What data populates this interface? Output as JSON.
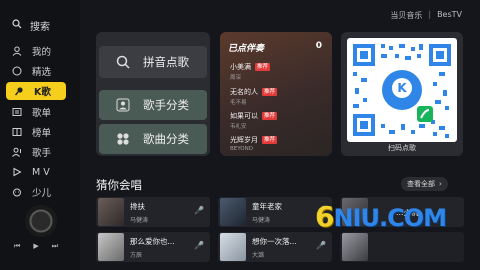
{
  "header": {
    "brand_left": "当贝音乐",
    "brand_right": "BesTV"
  },
  "sidebar": {
    "search_label": "搜索",
    "items": [
      {
        "label": "我的",
        "icon": "user-icon"
      },
      {
        "label": "精选",
        "icon": "circle-icon"
      },
      {
        "label": "K歌",
        "icon": "mic-icon",
        "active": true
      },
      {
        "label": "歌单",
        "icon": "playlist-icon"
      },
      {
        "label": "榜单",
        "icon": "chart-icon"
      },
      {
        "label": "歌手",
        "icon": "singer-icon"
      },
      {
        "label": "M V",
        "icon": "mv-icon"
      },
      {
        "label": "少儿",
        "icon": "kids-icon"
      }
    ],
    "player_controls": [
      "⏮",
      "▶",
      "⏭"
    ]
  },
  "cards": {
    "pinyin_label": "拼音点歌",
    "singer_label": "歌手分类",
    "songcat_label": "歌曲分类",
    "ordered": {
      "title": "已点伴奏",
      "count": "0",
      "songs": [
        {
          "title": "小美满",
          "artist": "周深",
          "tag": "推荐"
        },
        {
          "title": "无名的人",
          "artist": "毛不易",
          "tag": "推荐"
        },
        {
          "title": "如果可以",
          "artist": "韦礼安",
          "tag": "推荐"
        },
        {
          "title": "光辉岁月",
          "artist": "BEYOND",
          "tag": "推荐"
        }
      ]
    },
    "qr_label": "扫码点歌"
  },
  "guess": {
    "title": "猜你会唱",
    "view_all": "查看全部",
    "songs": [
      {
        "title": "搀扶",
        "artist": "马健涛"
      },
      {
        "title": "童年老家",
        "artist": "马健涛"
      },
      {
        "title": "…火机",
        "artist": ""
      },
      {
        "title": "那么爱你也...",
        "artist": "方辰"
      },
      {
        "title": "想你一次落...",
        "artist": "大潞"
      }
    ]
  },
  "watermark": {
    "lead": "6",
    "rest": "NIU.COM"
  },
  "colors": {
    "accent": "#f5cf1b",
    "tag": "#e23b3b",
    "qr_blue": "#2f86e8",
    "qr_green": "#18b45b"
  }
}
